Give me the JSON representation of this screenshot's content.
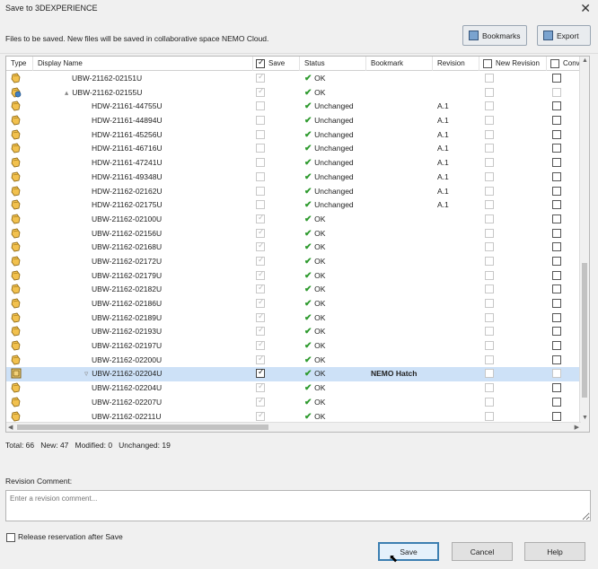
{
  "window": {
    "title": "Save to 3DEXPERIENCE",
    "close_glyph": "✕"
  },
  "info": "Files to be saved. New files will be saved in collaborative space NEMO Cloud.",
  "toolbar": {
    "bookmarks": "Bookmarks",
    "export": "Export"
  },
  "columns": {
    "type": "Type",
    "display_name": "Display Name",
    "save": "Save",
    "status": "Status",
    "bookmark": "Bookmark",
    "revision": "Revision",
    "new_revision": "New Revision",
    "conv": "Conv"
  },
  "rows": [
    {
      "name": "UBW-21162-02151U",
      "indent": 0,
      "expander": "",
      "status": "OK",
      "bookmark": "",
      "revision": "",
      "save": "checked-disabled",
      "nr": "disabled",
      "cv": "enabled"
    },
    {
      "name": "UBW-21162-02155U",
      "indent": 0,
      "expander": "▴",
      "status": "OK",
      "bookmark": "",
      "revision": "",
      "save": "checked-disabled",
      "nr": "disabled",
      "cv": "disabled"
    },
    {
      "name": "HDW-21161-44755U",
      "indent": 1,
      "expander": "",
      "status": "Unchanged",
      "bookmark": "",
      "revision": "A.1",
      "save": "disabled",
      "nr": "disabled",
      "cv": "enabled"
    },
    {
      "name": "HDW-21161-44894U",
      "indent": 1,
      "expander": "",
      "status": "Unchanged",
      "bookmark": "",
      "revision": "A.1",
      "save": "disabled",
      "nr": "disabled",
      "cv": "enabled"
    },
    {
      "name": "HDW-21161-45256U",
      "indent": 1,
      "expander": "",
      "status": "Unchanged",
      "bookmark": "",
      "revision": "A.1",
      "save": "disabled",
      "nr": "disabled",
      "cv": "enabled"
    },
    {
      "name": "HDW-21161-46716U",
      "indent": 1,
      "expander": "",
      "status": "Unchanged",
      "bookmark": "",
      "revision": "A.1",
      "save": "disabled",
      "nr": "disabled",
      "cv": "enabled"
    },
    {
      "name": "HDW-21161-47241U",
      "indent": 1,
      "expander": "",
      "status": "Unchanged",
      "bookmark": "",
      "revision": "A.1",
      "save": "disabled",
      "nr": "disabled",
      "cv": "enabled"
    },
    {
      "name": "HDW-21161-49348U",
      "indent": 1,
      "expander": "",
      "status": "Unchanged",
      "bookmark": "",
      "revision": "A.1",
      "save": "disabled",
      "nr": "disabled",
      "cv": "enabled"
    },
    {
      "name": "HDW-21162-02162U",
      "indent": 1,
      "expander": "",
      "status": "Unchanged",
      "bookmark": "",
      "revision": "A.1",
      "save": "disabled",
      "nr": "disabled",
      "cv": "enabled"
    },
    {
      "name": "HDW-21162-02175U",
      "indent": 1,
      "expander": "",
      "status": "Unchanged",
      "bookmark": "",
      "revision": "A.1",
      "save": "disabled",
      "nr": "disabled",
      "cv": "enabled"
    },
    {
      "name": "UBW-21162-02100U",
      "indent": 1,
      "expander": "",
      "status": "OK",
      "bookmark": "",
      "revision": "",
      "save": "checked-disabled",
      "nr": "disabled",
      "cv": "enabled"
    },
    {
      "name": "UBW-21162-02156U",
      "indent": 1,
      "expander": "",
      "status": "OK",
      "bookmark": "",
      "revision": "",
      "save": "checked-disabled",
      "nr": "disabled",
      "cv": "enabled"
    },
    {
      "name": "UBW-21162-02168U",
      "indent": 1,
      "expander": "",
      "status": "OK",
      "bookmark": "",
      "revision": "",
      "save": "checked-disabled",
      "nr": "disabled",
      "cv": "enabled"
    },
    {
      "name": "UBW-21162-02172U",
      "indent": 1,
      "expander": "",
      "status": "OK",
      "bookmark": "",
      "revision": "",
      "save": "checked-disabled",
      "nr": "disabled",
      "cv": "enabled"
    },
    {
      "name": "UBW-21162-02179U",
      "indent": 1,
      "expander": "",
      "status": "OK",
      "bookmark": "",
      "revision": "",
      "save": "checked-disabled",
      "nr": "disabled",
      "cv": "enabled"
    },
    {
      "name": "UBW-21162-02182U",
      "indent": 1,
      "expander": "",
      "status": "OK",
      "bookmark": "",
      "revision": "",
      "save": "checked-disabled",
      "nr": "disabled",
      "cv": "enabled"
    },
    {
      "name": "UBW-21162-02186U",
      "indent": 1,
      "expander": "",
      "status": "OK",
      "bookmark": "",
      "revision": "",
      "save": "checked-disabled",
      "nr": "disabled",
      "cv": "enabled"
    },
    {
      "name": "UBW-21162-02189U",
      "indent": 1,
      "expander": "",
      "status": "OK",
      "bookmark": "",
      "revision": "",
      "save": "checked-disabled",
      "nr": "disabled",
      "cv": "enabled"
    },
    {
      "name": "UBW-21162-02193U",
      "indent": 1,
      "expander": "",
      "status": "OK",
      "bookmark": "",
      "revision": "",
      "save": "checked-disabled",
      "nr": "disabled",
      "cv": "enabled"
    },
    {
      "name": "UBW-21162-02197U",
      "indent": 1,
      "expander": "",
      "status": "OK",
      "bookmark": "",
      "revision": "",
      "save": "checked-disabled",
      "nr": "disabled",
      "cv": "enabled"
    },
    {
      "name": "UBW-21162-02200U",
      "indent": 1,
      "expander": "",
      "status": "OK",
      "bookmark": "",
      "revision": "",
      "save": "checked-disabled",
      "nr": "disabled",
      "cv": "enabled"
    },
    {
      "name": "UBW-21162-02204U",
      "indent": 1,
      "expander": "▿",
      "status": "OK",
      "bookmark": "NEMO Hatch",
      "revision": "",
      "save": "checked",
      "nr": "disabled",
      "cv": "disabled",
      "selected": true
    },
    {
      "name": "UBW-21162-02204U",
      "indent": 1,
      "expander": "",
      "status": "OK",
      "bookmark": "",
      "revision": "",
      "save": "checked-disabled",
      "nr": "disabled",
      "cv": "enabled"
    },
    {
      "name": "UBW-21162-02207U",
      "indent": 1,
      "expander": "",
      "status": "OK",
      "bookmark": "",
      "revision": "",
      "save": "checked-disabled",
      "nr": "disabled",
      "cv": "enabled"
    },
    {
      "name": "UBW-21162-02211U",
      "indent": 1,
      "expander": "",
      "status": "OK",
      "bookmark": "",
      "revision": "",
      "save": "checked-disabled",
      "nr": "disabled",
      "cv": "enabled"
    }
  ],
  "stats": "Total: 66   New: 47   Modified: 0   Unchanged: 19",
  "revision_comment": {
    "label": "Revision Comment:",
    "placeholder": "Enter a revision comment..."
  },
  "release_label": "Release reservation after Save",
  "buttons": {
    "save": "Save",
    "cancel": "Cancel",
    "help": "Help"
  },
  "icons": {
    "part": "part-icon",
    "assembly": "assembly-icon",
    "selected": "selected-part-icon"
  },
  "colors": {
    "ok": "#2e9a2e",
    "selection": "#cde1f7",
    "primary_border": "#3c7fb1"
  }
}
